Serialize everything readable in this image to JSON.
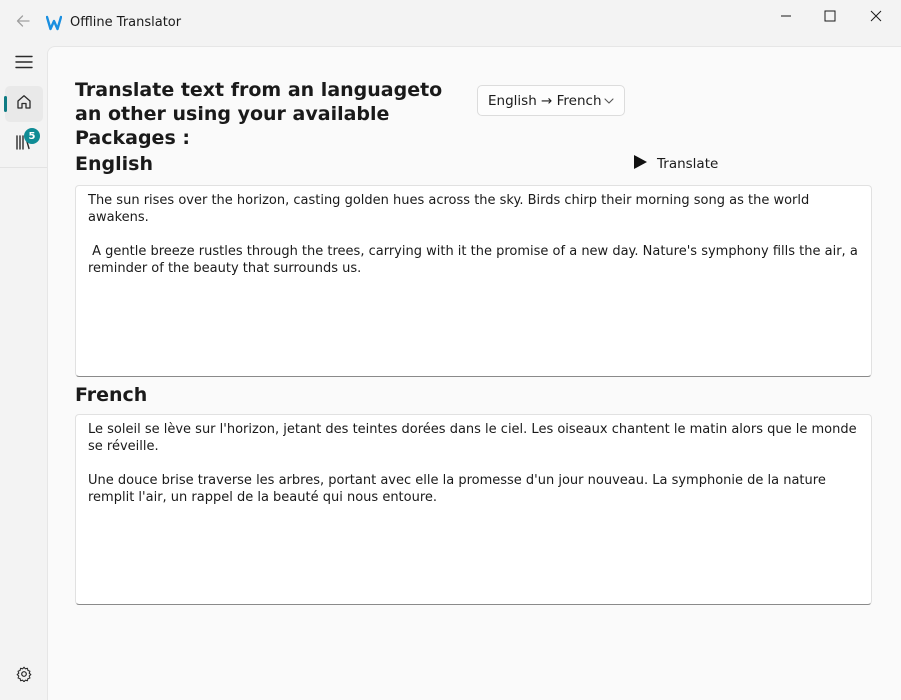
{
  "window": {
    "title": "Offline Translator",
    "accent_color": "#0f7b83"
  },
  "nav": {
    "items": [
      {
        "name": "menu",
        "icon": "hamburger-icon"
      },
      {
        "name": "home",
        "icon": "home-icon",
        "selected": true
      },
      {
        "name": "packages",
        "icon": "library-icon",
        "badge": "5"
      }
    ],
    "footer": {
      "name": "settings",
      "icon": "gear-icon"
    }
  },
  "main": {
    "heading": "Translate text from an languageto\nan other using your available Packages :",
    "language_pair": "English → French",
    "source_label": "English",
    "target_label": "French",
    "translate_label": "Translate",
    "source_text": "The sun rises over the horizon, casting golden hues across the sky. Birds chirp their morning song as the world awakens.\n\n A gentle breeze rustles through the trees, carrying with it the promise of a new day. Nature's symphony fills the air, a reminder of the beauty that surrounds us.",
    "target_text": "Le soleil se lève sur l'horizon, jetant des teintes dorées dans le ciel. Les oiseaux chantent le matin alors que le monde se réveille.\n\nUne douce brise traverse les arbres, portant avec elle la promesse d'un jour nouveau. La symphonie de la nature remplit l'air, un rappel de la beauté qui nous entoure."
  }
}
